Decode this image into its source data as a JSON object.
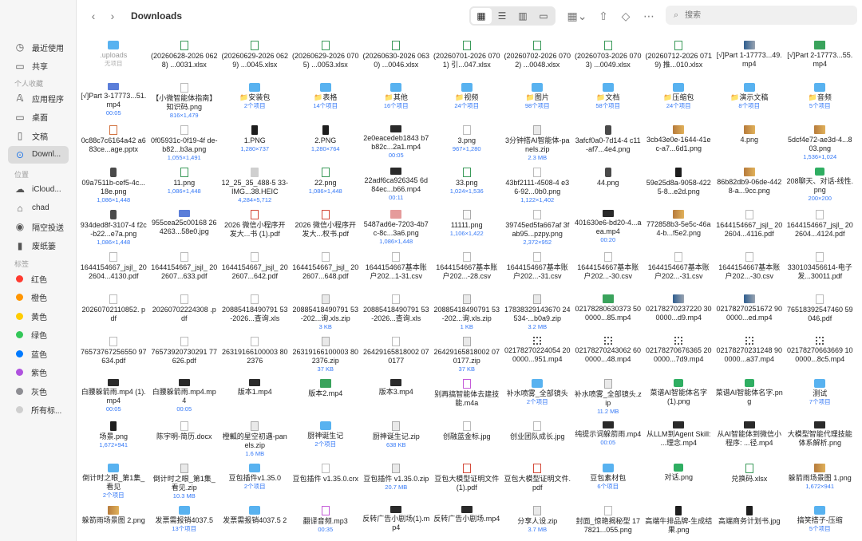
{
  "toolbar": {
    "title": "Downloads",
    "search_placeholder": "搜索",
    "back_icon": "chevron-left-icon",
    "forward_icon": "chevron-right-icon"
  },
  "sidebar": {
    "favorites": [
      {
        "label": "最近使用",
        "icon": "clock-icon",
        "active": false
      },
      {
        "label": "共享",
        "icon": "shared-folder-icon",
        "active": false
      },
      {
        "section": "个人收藏"
      },
      {
        "label": "应用程序",
        "icon": "applications-icon",
        "active": false
      },
      {
        "label": "桌面",
        "icon": "desktop-icon",
        "active": false
      },
      {
        "label": "文稿",
        "icon": "documents-icon",
        "active": false
      },
      {
        "label": "Downl...",
        "icon": "download-icon",
        "active": true
      }
    ],
    "locations_title": "位置",
    "locations": [
      {
        "label": "iCloud...",
        "icon": "icloud-icon"
      },
      {
        "label": "chad",
        "icon": "home-icon"
      },
      {
        "label": "隔空投送",
        "icon": "airdrop-icon"
      },
      {
        "label": "废纸篓",
        "icon": "trash-icon"
      }
    ],
    "tags_title": "标签",
    "tags": [
      {
        "label": "红色",
        "color": "#ff3b30"
      },
      {
        "label": "橙色",
        "color": "#ff9500"
      },
      {
        "label": "黄色",
        "color": "#ffcc00"
      },
      {
        "label": "绿色",
        "color": "#34c759"
      },
      {
        "label": "蓝色",
        "color": "#007aff"
      },
      {
        "label": "紫色",
        "color": "#af52de"
      },
      {
        "label": "灰色",
        "color": "#8e8e93"
      },
      {
        "label": "所有标...",
        "color": "#cfcfcf"
      }
    ]
  },
  "files": [
    {
      "name": ".uploads",
      "meta": "无项目",
      "icon": "folder",
      "dim": true
    },
    {
      "name": "(20260628-2026 0628) ...0031.xlsx",
      "meta": "",
      "icon": "xlsx"
    },
    {
      "name": "(20260629-2026 0629) ...0045.xlsx",
      "meta": "",
      "icon": "xlsx"
    },
    {
      "name": "(20260629-2026 0705) ...0053.xlsx",
      "meta": "",
      "icon": "xlsx"
    },
    {
      "name": "(20260630-2026 0630) ...0046.xlsx",
      "meta": "",
      "icon": "xlsx"
    },
    {
      "name": "(20260701-2026 0701) 引...047.xlsx",
      "meta": "",
      "icon": "xlsx"
    },
    {
      "name": "(20260702-2026 0702) ...0048.xlsx",
      "meta": "",
      "icon": "xlsx"
    },
    {
      "name": "(20260703-2026 0703) ...0049.xlsx",
      "meta": "",
      "icon": "xlsx"
    },
    {
      "name": "(20260712-2026 0719) 推...010.xlsx",
      "meta": "",
      "icon": "xlsx"
    },
    {
      "name": "[√]Part 1-17773...49.mp4",
      "meta": "",
      "icon": "imgmix"
    },
    {
      "name": "[√]Part 2-17773...55.mp4",
      "meta": "",
      "icon": "imggreen"
    },
    {
      "name": "[√]Part 3-17773...51.mp4",
      "meta": "00:05",
      "icon": "imgblue"
    },
    {
      "name": "【小微智能体指南】知识码.png",
      "meta": "816×1,479",
      "icon": "doc"
    },
    {
      "name": "📁安装包",
      "meta": "2个项目",
      "icon": "folder"
    },
    {
      "name": "📁表格",
      "meta": "14个项目",
      "icon": "folder"
    },
    {
      "name": "📁其他",
      "meta": "16个项目",
      "icon": "folder"
    },
    {
      "name": "📁视频",
      "meta": "24个项目",
      "icon": "folder"
    },
    {
      "name": "📁图片",
      "meta": "98个项目",
      "icon": "folder"
    },
    {
      "name": "📁文档",
      "meta": "58个项目",
      "icon": "folder"
    },
    {
      "name": "📁压缩包",
      "meta": "24个项目",
      "icon": "folder"
    },
    {
      "name": "📁演示文稿",
      "meta": "8个项目",
      "icon": "folder"
    },
    {
      "name": "📁音频",
      "meta": "5个项目",
      "icon": "folder"
    },
    {
      "name": "0c88c7c6164a42 a683ce...age.pptx",
      "meta": "",
      "icon": "pptx"
    },
    {
      "name": "0f05931c-0f19-4f de-b82...b3a.png",
      "meta": "1,055×1,491",
      "icon": "doc"
    },
    {
      "name": "1.PNG",
      "meta": "1,280×737",
      "icon": "imgdark"
    },
    {
      "name": "2.PNG",
      "meta": "1,280×764",
      "icon": "imgdark"
    },
    {
      "name": "2e0eacedeb1843 b7b82c...2a1.mp4",
      "meta": "00:05",
      "icon": "video"
    },
    {
      "name": "3.png",
      "meta": "967×1,280",
      "icon": "doc"
    },
    {
      "name": "3分钟搭AI智能体-panels.zip",
      "meta": "2.3 MB",
      "icon": "zip"
    },
    {
      "name": "3afcf0a0-7d14-4 c11-af7...4e4.png",
      "meta": "",
      "icon": "imgphone"
    },
    {
      "name": "3cb43e0e-1644-41ec-a7...6d1.png",
      "meta": "",
      "icon": "imgcolor"
    },
    {
      "name": "4.png",
      "meta": "",
      "icon": "imgcolor"
    },
    {
      "name": "5dcf4e72-ae3d-4...803.png",
      "meta": "1,536×1,024",
      "icon": "imgcolor"
    },
    {
      "name": "09a7511b-cef5-4c...18e.png",
      "meta": "1,086×1,448",
      "icon": "imgphone"
    },
    {
      "name": "11.png",
      "meta": "1,086×1,448",
      "icon": "green"
    },
    {
      "name": "12_25_35_488-5 33-IMG...38.HEIC",
      "meta": "4,284×5,712",
      "icon": "heic"
    },
    {
      "name": "22.png",
      "meta": "1,086×1,448",
      "icon": "green"
    },
    {
      "name": "22adf6ca926345 6d84ec...b66.mp4",
      "meta": "00:11",
      "icon": "video"
    },
    {
      "name": "33.png",
      "meta": "1,024×1,536",
      "icon": "green"
    },
    {
      "name": "43bf2111-4508-4 e36-92...0b0.png",
      "meta": "1,122×1,402",
      "icon": "doc"
    },
    {
      "name": "44.png",
      "meta": "",
      "icon": "imgphone"
    },
    {
      "name": "59e25d8a-9058-4225-8...e2d.png",
      "meta": "",
      "icon": "imgdark"
    },
    {
      "name": "86b82db9-06de-4428-a...9cc.png",
      "meta": "",
      "icon": "imgcolor"
    },
    {
      "name": "208聊天、对话-线性.png",
      "meta": "200×200",
      "icon": "green2"
    },
    {
      "name": "934ded8f-3107-4 f2c-b22...e7a.png",
      "meta": "1,086×1,448",
      "icon": "imgphone"
    },
    {
      "name": "955cea25c00168 264263...58e0.jpg",
      "meta": "",
      "icon": "imgblue"
    },
    {
      "name": "2026 微信小程序开发大...书 (1).pdf",
      "meta": "",
      "icon": "pdf"
    },
    {
      "name": "2026 微信小程序开发大...权书.pdf",
      "meta": "",
      "icon": "pdf"
    },
    {
      "name": "5487ad6e-7203-4b7c-8c...3a6.png",
      "meta": "1,086×1,448",
      "icon": "imgpink"
    },
    {
      "name": "11111.png",
      "meta": "1,106×1,422",
      "icon": "doclines"
    },
    {
      "name": "39745ed5fa667af 3fab95...pzpy.png",
      "meta": "2,372×952",
      "icon": "doc"
    },
    {
      "name": "401630e6-bd20-4...aea.mp4",
      "meta": "00:20",
      "icon": "video"
    },
    {
      "name": "772858b3-5e5c-46a4-b...f5e2.png",
      "meta": "",
      "icon": "imgcolor"
    },
    {
      "name": "1644154667_jsjl_ 202604...4116.pdf",
      "meta": "",
      "icon": "doc"
    },
    {
      "name": "1644154667_jsjl_ 202604...4124.pdf",
      "meta": "",
      "icon": "doc"
    },
    {
      "name": "1644154667_jsjl_ 202604...4130.pdf",
      "meta": "",
      "icon": "doc"
    },
    {
      "name": "1644154667_jsjl_ 202607...633.pdf",
      "meta": "",
      "icon": "doc"
    },
    {
      "name": "1644154667_jsjl_ 202607...642.pdf",
      "meta": "",
      "icon": "doc"
    },
    {
      "name": "1644154667_jsjl_ 202607...648.pdf",
      "meta": "",
      "icon": "doc"
    },
    {
      "name": "1644154667基本账户202...1-31.csv",
      "meta": "",
      "icon": "doc"
    },
    {
      "name": "1644154667基本账户202...-28.csv",
      "meta": "",
      "icon": "doc"
    },
    {
      "name": "1644154667基本账户202...-31.csv",
      "meta": "",
      "icon": "doc"
    },
    {
      "name": "1644154667基本账户202...-30.csv",
      "meta": "",
      "icon": "doc"
    },
    {
      "name": "1644154667基本账户202...-31.csv",
      "meta": "",
      "icon": "doc"
    },
    {
      "name": "1644154667基本账户202...-30.csv",
      "meta": "",
      "icon": "doc"
    },
    {
      "name": "330103456614-电子发...30011.pdf",
      "meta": "",
      "icon": "doc"
    },
    {
      "name": "20260702110852. pdf",
      "meta": "",
      "icon": "doc"
    },
    {
      "name": "20260702224308 .pdf",
      "meta": "",
      "icon": "doc"
    },
    {
      "name": "20885418490791 53-2026...查询.xls",
      "meta": "",
      "icon": "doc"
    },
    {
      "name": "20885418490791 53-202...询.xls.zip",
      "meta": "3 KB",
      "icon": "zip"
    },
    {
      "name": "20885418490791 53-2026...查询.xls",
      "meta": "",
      "icon": "doc"
    },
    {
      "name": "20885418490791 53-202...询.xls.zip",
      "meta": "1 KB",
      "icon": "zip"
    },
    {
      "name": "17838329143670 24534-...b0a9.zip",
      "meta": "3.2 MB",
      "icon": "zip"
    },
    {
      "name": "02178280630373 500000...85.mp4",
      "meta": "",
      "icon": "imggreen"
    },
    {
      "name": "02178270237220 300000...d9.mp4",
      "meta": "",
      "icon": "imgmix"
    },
    {
      "name": "02178270251672 900000...ed.mp4",
      "meta": "",
      "icon": "imgmix"
    },
    {
      "name": "76518392547460 59046.pdf",
      "meta": "",
      "icon": "doc"
    },
    {
      "name": "76573767256550 97634.pdf",
      "meta": "",
      "icon": "doc"
    },
    {
      "name": "76573920730291 77626.pdf",
      "meta": "",
      "icon": "doc"
    },
    {
      "name": "26319166100003 802376",
      "meta": "",
      "icon": "doc"
    },
    {
      "name": "26319166100003 802376.zip",
      "meta": "37 KB",
      "icon": "zip"
    },
    {
      "name": "26429165818002 070177",
      "meta": "",
      "icon": "doc"
    },
    {
      "name": "26429165818002 070177.zip",
      "meta": "37 KB",
      "icon": "zip"
    },
    {
      "name": "02178270224054 200000...951.mp4",
      "meta": "",
      "icon": "qr"
    },
    {
      "name": "02178270243062 600000...48.mp4",
      "meta": "",
      "icon": "qr"
    },
    {
      "name": "02178270676365 200000...7d9.mp4",
      "meta": "",
      "icon": "qr"
    },
    {
      "name": "02178270231248 900000...a37.mp4",
      "meta": "",
      "icon": "qr"
    },
    {
      "name": "02178270663669 100000...8c5.mp4",
      "meta": "",
      "icon": "qr"
    },
    {
      "name": "白腰躲箭雨.mp4 (1).mp4",
      "meta": "00:05",
      "icon": "video"
    },
    {
      "name": "白腰躲箭雨.mp4.mp4",
      "meta": "00:05",
      "icon": "video"
    },
    {
      "name": "版本1.mp4",
      "meta": "",
      "icon": "video"
    },
    {
      "name": "版本2.mp4",
      "meta": "",
      "icon": "imggreen"
    },
    {
      "name": "版本3.mp4",
      "meta": "",
      "icon": "video"
    },
    {
      "name": "别再搞智能体去建技能.m4a",
      "meta": "",
      "icon": "audio"
    },
    {
      "name": "补水喷雾_全部镜头",
      "meta": "2个项目",
      "icon": "folder"
    },
    {
      "name": "补水喷雾_全部镜头.zip",
      "meta": "11.2 MB",
      "icon": "zip"
    },
    {
      "name": "菜谱AI智能体名字(1).png",
      "meta": "",
      "icon": "green2"
    },
    {
      "name": "菜谱AI智能体名字.png",
      "meta": "",
      "icon": "green2"
    },
    {
      "name": "测试",
      "meta": "7个项目",
      "icon": "folder"
    },
    {
      "name": "场景.png",
      "meta": "1,672×941",
      "icon": "imgdark"
    },
    {
      "name": "陈宇明-简历.docx",
      "meta": "",
      "icon": "doc"
    },
    {
      "name": "橙瓤的星空初遇-panels.zip",
      "meta": "1.6 MB",
      "icon": "zip"
    },
    {
      "name": "厨神诞生记",
      "meta": "2个项目",
      "icon": "folder"
    },
    {
      "name": "厨神诞生记.zip",
      "meta": "638 KB",
      "icon": "zip"
    },
    {
      "name": "创融蓝金标.jpg",
      "meta": "",
      "icon": "doc"
    },
    {
      "name": "创业团队成长.jpg",
      "meta": "",
      "icon": "doc"
    },
    {
      "name": "纯提示词躲箭雨.mp4",
      "meta": "00:05",
      "icon": "video"
    },
    {
      "name": "从LLM到Agent Skill: ...理念.mp4",
      "meta": "",
      "icon": "video"
    },
    {
      "name": "从AI智能体到微信小程序: ...径.mp4",
      "meta": "",
      "icon": "video"
    },
    {
      "name": "大模型智能代理技能体系解析.png",
      "meta": "",
      "icon": "video"
    },
    {
      "name": "倒计时之眼_第1集_看见",
      "meta": "2个项目",
      "icon": "folder"
    },
    {
      "name": "倒计时之眼_第1集_看见.zip",
      "meta": "10.3 MB",
      "icon": "zip"
    },
    {
      "name": "豆包插件v1.35.0",
      "meta": "2个项目",
      "icon": "folder"
    },
    {
      "name": "豆包插件 v1.35.0.crx",
      "meta": "",
      "icon": "doc"
    },
    {
      "name": "豆包插件 v1.35.0.zip",
      "meta": "20.7 MB",
      "icon": "zip"
    },
    {
      "name": "豆包大模型证明文件(1).pdf",
      "meta": "",
      "icon": "pdf"
    },
    {
      "name": "豆包大模型证明文件.pdf",
      "meta": "",
      "icon": "pdf"
    },
    {
      "name": "豆包素材包",
      "meta": "6个项目",
      "icon": "folder"
    },
    {
      "name": "对话.png",
      "meta": "",
      "icon": "green2"
    },
    {
      "name": "兑换码.xlsx",
      "meta": "",
      "icon": "xlsx"
    },
    {
      "name": "躲箭雨场景图 1.png",
      "meta": "1,672×941",
      "icon": "imgcolor"
    },
    {
      "name": "躲箭雨场景图 2.png",
      "meta": "",
      "icon": "imgcolor"
    },
    {
      "name": "发票需报销4037.5",
      "meta": "13个项目",
      "icon": "folder"
    },
    {
      "name": "发票需报销4037.5 2",
      "meta": "",
      "icon": "folder"
    },
    {
      "name": "翻译音频.mp3",
      "meta": "00:35",
      "icon": "audio"
    },
    {
      "name": "反转广告小剧场(1).mp4",
      "meta": "",
      "icon": "video"
    },
    {
      "name": "反转广告小剧场.mp4",
      "meta": "",
      "icon": "video"
    },
    {
      "name": "分享人设.zip",
      "meta": "3.7 MB",
      "icon": "zip"
    },
    {
      "name": "封面_惊艳揭秘型 177821...055.png",
      "meta": "",
      "icon": "doc"
    },
    {
      "name": "高端牛排品牌-生成结果.png",
      "meta": "",
      "icon": "imgdark"
    },
    {
      "name": "高端商务计划书.jpg",
      "meta": "",
      "icon": "imgdark"
    },
    {
      "name": "搞笑搭子-压缩",
      "meta": "5个项目",
      "icon": "folder"
    }
  ]
}
